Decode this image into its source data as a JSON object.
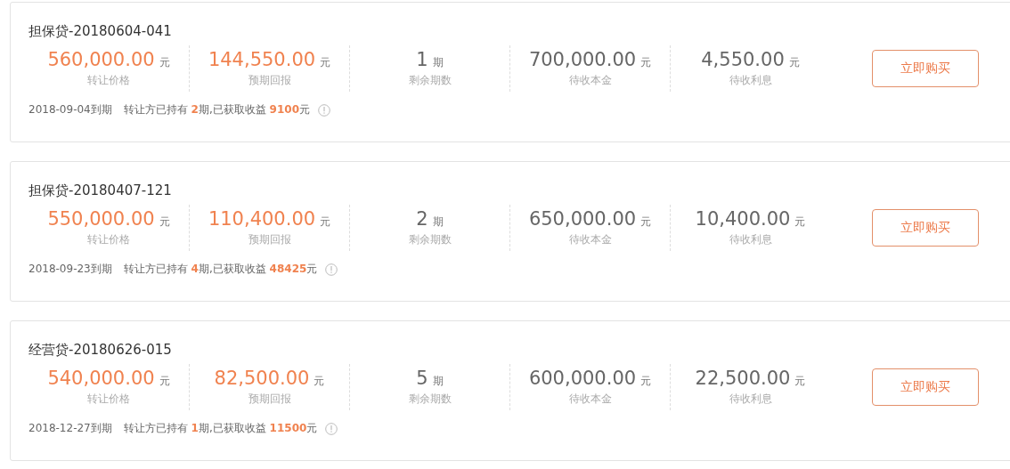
{
  "listings": [
    {
      "title": "担保贷-20180604-041",
      "stats": [
        {
          "value": "560,000.00",
          "unit": "元",
          "label": "转让价格",
          "accent": true
        },
        {
          "value": "144,550.00",
          "unit": "元",
          "label": "预期回报",
          "accent": true
        },
        {
          "value": "1",
          "unit": "期",
          "label": "剩余期数",
          "accent": false
        },
        {
          "value": "700,000.00",
          "unit": "元",
          "label": "待收本金",
          "accent": false
        },
        {
          "value": "4,550.00",
          "unit": "元",
          "label": "待收利息",
          "accent": false
        }
      ],
      "button": "立即购买",
      "due": "2018-09-04到期",
      "note": "转让方已持有 **2**期,已获取收益 **9100**元"
    },
    {
      "title": "担保贷-20180407-121",
      "stats": [
        {
          "value": "550,000.00",
          "unit": "元",
          "label": "转让价格",
          "accent": true
        },
        {
          "value": "110,400.00",
          "unit": "元",
          "label": "预期回报",
          "accent": true
        },
        {
          "value": "2",
          "unit": "期",
          "label": "剩余期数",
          "accent": false
        },
        {
          "value": "650,000.00",
          "unit": "元",
          "label": "待收本金",
          "accent": false
        },
        {
          "value": "10,400.00",
          "unit": "元",
          "label": "待收利息",
          "accent": false
        }
      ],
      "button": "立即购买",
      "due": "2018-09-23到期",
      "note": "转让方已持有 **4**期,已获取收益 **48425**元"
    },
    {
      "title": "经营贷-20180626-015",
      "stats": [
        {
          "value": "540,000.00",
          "unit": "元",
          "label": "转让价格",
          "accent": true
        },
        {
          "value": "82,500.00",
          "unit": "元",
          "label": "预期回报",
          "accent": true
        },
        {
          "value": "5",
          "unit": "期",
          "label": "剩余期数",
          "accent": false
        },
        {
          "value": "600,000.00",
          "unit": "元",
          "label": "待收本金",
          "accent": false
        },
        {
          "value": "22,500.00",
          "unit": "元",
          "label": "待收利息",
          "accent": false
        }
      ],
      "button": "立即购买",
      "due": "2018-12-27到期",
      "note": "转让方已持有 **1**期,已获取收益 **11500**元"
    }
  ]
}
